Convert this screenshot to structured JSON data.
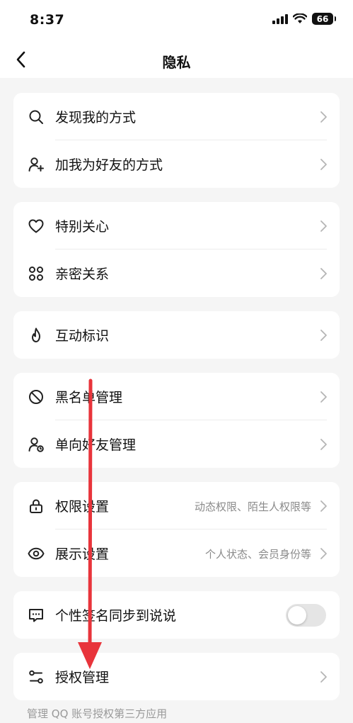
{
  "status_bar": {
    "time": "8:37",
    "battery": "66"
  },
  "nav": {
    "title": "隐私"
  },
  "groups": [
    {
      "items": [
        {
          "label": "发现我的方式",
          "icon": "search-icon"
        },
        {
          "label": "加我为好友的方式",
          "icon": "add-friend-icon"
        }
      ]
    },
    {
      "items": [
        {
          "label": "特别关心",
          "icon": "heart-icon"
        },
        {
          "label": "亲密关系",
          "icon": "intimacy-icon"
        }
      ]
    },
    {
      "items": [
        {
          "label": "互动标识",
          "icon": "flame-icon"
        }
      ]
    },
    {
      "items": [
        {
          "label": "黑名单管理",
          "icon": "block-icon"
        },
        {
          "label": "单向好友管理",
          "icon": "one-way-friend-icon"
        }
      ]
    },
    {
      "items": [
        {
          "label": "权限设置",
          "desc": "动态权限、陌生人权限等",
          "icon": "lock-icon"
        },
        {
          "label": "展示设置",
          "desc": "个人状态、会员身份等",
          "icon": "eye-icon"
        }
      ]
    },
    {
      "items": [
        {
          "label": "个性签名同步到说说",
          "icon": "message-icon",
          "toggle_on": false
        }
      ]
    },
    {
      "items": [
        {
          "label": "授权管理",
          "icon": "authorization-icon"
        }
      ]
    }
  ],
  "footnote": "管理 QQ 账号授权第三方应用",
  "colors": {
    "annotation_arrow": "#e8343b",
    "secondary_text": "#8a8a8a",
    "background": "#f5f5f5"
  }
}
